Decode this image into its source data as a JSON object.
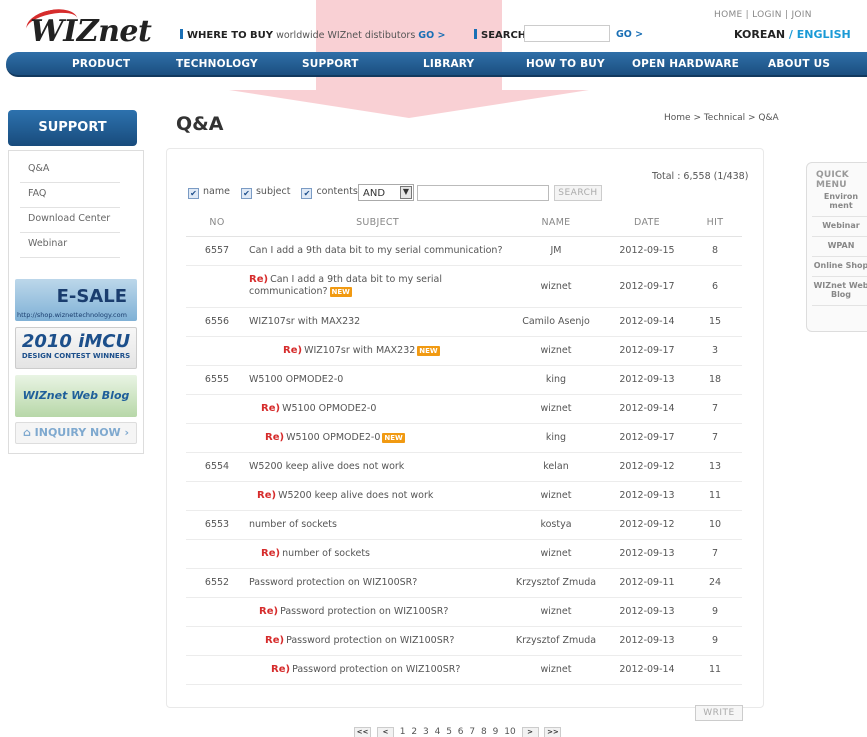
{
  "header": {
    "logo_text": "WIZnet",
    "where_label": "WHERE TO BUY",
    "where_text": "worldwide WIZnet distibutors",
    "go1": "GO >",
    "search_label": "SEARCH",
    "search_value": "",
    "go2": "GO >",
    "top_links": "HOME  |  LOGIN  |  JOIN",
    "lang_korean": "KOREAN",
    "lang_sep": " / ",
    "lang_english": "ENGLISH"
  },
  "nav": {
    "product": "PRODUCT",
    "technology": "TECHNOLOGY",
    "support": "SUPPORT",
    "library": "LIBRARY",
    "how_to_buy": "HOW TO BUY",
    "open_hardware": "OPEN HARDWARE",
    "about_us": "ABOUT US"
  },
  "sidebar": {
    "title": "SUPPORT",
    "items": [
      "Q&A",
      "FAQ",
      "Download Center",
      "Webinar"
    ],
    "banner_esale": "E-SALE",
    "banner_esale_url": "http://shop.wiznettechnology.com",
    "banner_imcu": "2010 iMCU",
    "banner_imcu_sub": "DESIGN CONTEST WINNERS",
    "banner_blog": "WIZnet Web Blog",
    "banner_inquiry": "INQUIRY NOW"
  },
  "main": {
    "title": "Q&A",
    "breadcrumb": "Home > Technical > Q&A",
    "total": "Total : 6,558 (1/438)",
    "filter_name": "name",
    "filter_subject": "subject",
    "filter_contents": "contents",
    "operator": "AND",
    "keyword": "",
    "search_button": "SEARCH",
    "write_button": "WRITE"
  },
  "table": {
    "headers": {
      "no": "NO",
      "subject": "SUBJECT",
      "name": "NAME",
      "date": "DATE",
      "hit": "HIT"
    },
    "rows": [
      {
        "no": "6557",
        "re": "",
        "subject": "Can I add a 9th data bit to my serial communication?",
        "name": "JM",
        "date": "2012-09-15",
        "hit": "8",
        "new": ""
      },
      {
        "no": "",
        "re": "Re)",
        "subject": "Can I add a 9th data bit to my serial communication?",
        "name": "wiznet",
        "date": "2012-09-17",
        "hit": "6",
        "new": "NEW"
      },
      {
        "no": "6556",
        "re": "",
        "subject": "WIZ107sr with MAX232",
        "name": "Camilo Asenjo",
        "date": "2012-09-14",
        "hit": "15",
        "new": ""
      },
      {
        "no": "",
        "re": "Re)",
        "subject": "WIZ107sr with MAX232",
        "name": "wiznet",
        "date": "2012-09-17",
        "hit": "3",
        "new": "NEW"
      },
      {
        "no": "6555",
        "re": "",
        "subject": "W5100 OPMODE2-0",
        "name": "king",
        "date": "2012-09-13",
        "hit": "18",
        "new": ""
      },
      {
        "no": "",
        "re": "Re)",
        "subject": "W5100 OPMODE2-0",
        "name": "wiznet",
        "date": "2012-09-14",
        "hit": "7",
        "new": ""
      },
      {
        "no": "",
        "re": "Re)",
        "subject": "W5100 OPMODE2-0",
        "name": "king",
        "date": "2012-09-17",
        "hit": "7",
        "new": "NEW"
      },
      {
        "no": "6554",
        "re": "",
        "subject": "W5200 keep alive does not work",
        "name": "kelan",
        "date": "2012-09-12",
        "hit": "13",
        "new": ""
      },
      {
        "no": "",
        "re": "Re)",
        "subject": "W5200 keep alive does not work",
        "name": "wiznet",
        "date": "2012-09-13",
        "hit": "11",
        "new": ""
      },
      {
        "no": "6553",
        "re": "",
        "subject": "number of sockets",
        "name": "kostya",
        "date": "2012-09-12",
        "hit": "10",
        "new": ""
      },
      {
        "no": "",
        "re": "Re)",
        "subject": "number of sockets",
        "name": "wiznet",
        "date": "2012-09-13",
        "hit": "7",
        "new": ""
      },
      {
        "no": "6552",
        "re": "",
        "subject": "Password protection on WIZ100SR?",
        "name": "Krzysztof Zmuda",
        "date": "2012-09-11",
        "hit": "24",
        "new": ""
      },
      {
        "no": "",
        "re": "Re)",
        "subject": "Password protection on WIZ100SR?",
        "name": "wiznet",
        "date": "2012-09-13",
        "hit": "9",
        "new": ""
      },
      {
        "no": "",
        "re": "Re)",
        "subject": "Password protection on WIZ100SR?",
        "name": "Krzysztof Zmuda",
        "date": "2012-09-13",
        "hit": "9",
        "new": ""
      },
      {
        "no": "",
        "re": "Re)",
        "subject": "Password protection on WIZ100SR?",
        "name": "wiznet",
        "date": "2012-09-14",
        "hit": "11",
        "new": ""
      }
    ]
  },
  "pager": {
    "first": "<<",
    "prev": "<",
    "pages": [
      "1",
      "2",
      "3",
      "4",
      "5",
      "6",
      "7",
      "8",
      "9",
      "10"
    ],
    "next": ">",
    "last": ">>"
  },
  "quick_menu": {
    "title": "QUICK MENU",
    "items": [
      "Environ ment",
      "Webinar",
      "WPAN",
      "Online Shop",
      "WIZnet Web Blog"
    ]
  },
  "colors": {
    "accent": "#1a6fb5",
    "nav": "#2f6fa8",
    "re": "#d62c2c",
    "new_badge": "#f19a12",
    "lang_en": "#1a9ad6"
  }
}
